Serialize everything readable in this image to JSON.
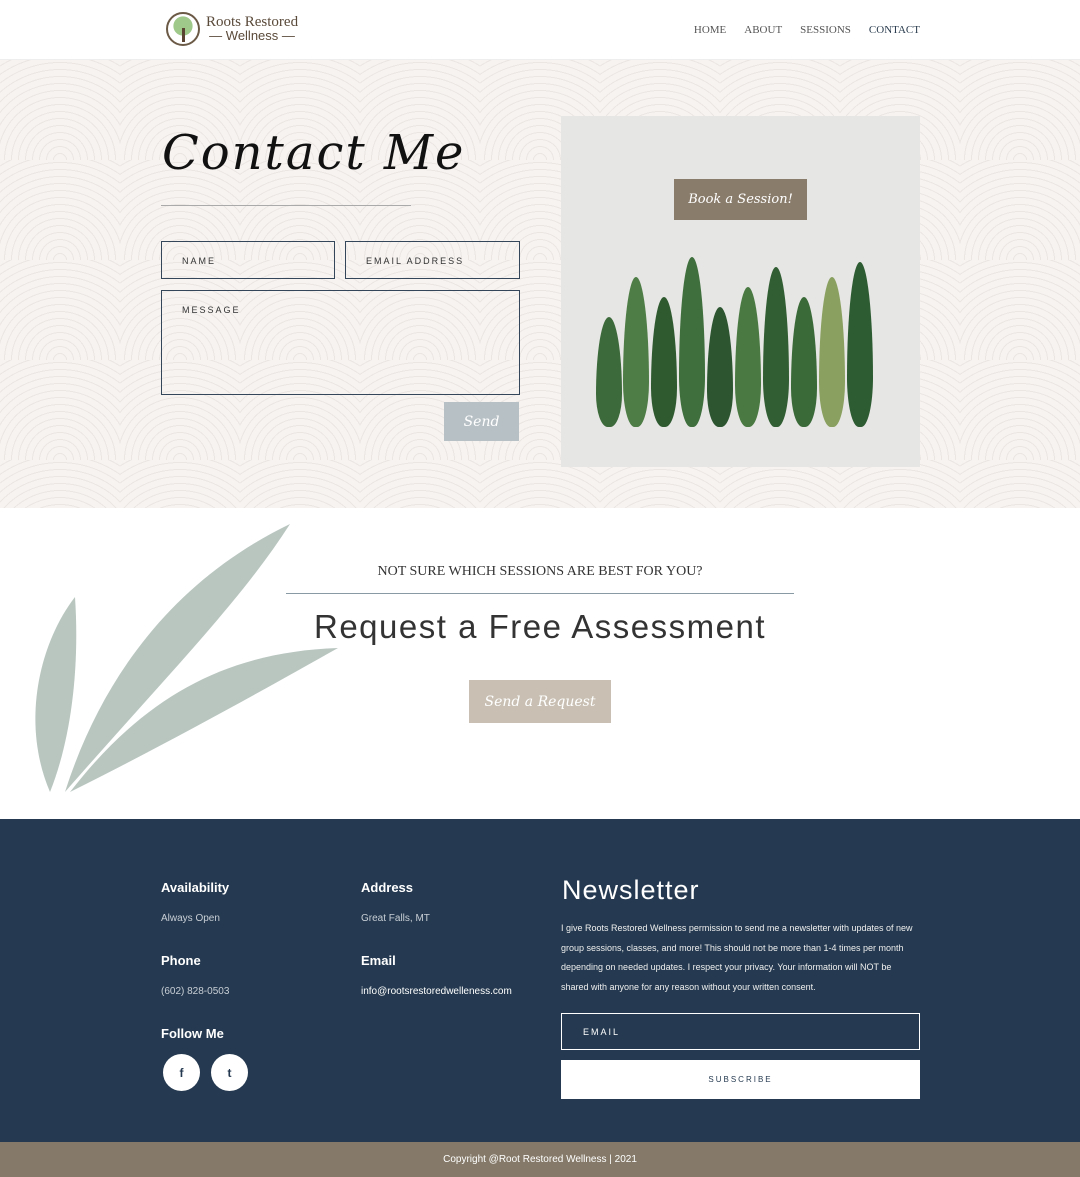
{
  "header": {
    "logo_line1": "Roots Restored",
    "logo_line2": "— Wellness —",
    "nav": [
      "HOME",
      "ABOUT",
      "SESSIONS",
      "CONTACT"
    ],
    "active": "CONTACT"
  },
  "contact": {
    "title": "Contact Me",
    "name_placeholder": "NAME",
    "email_placeholder": "EMAIL ADDRESS",
    "message_placeholder": "MESSAGE",
    "send_label": "Send",
    "book_label": "Book a Session!"
  },
  "cta": {
    "subtitle": "NOT SURE WHICH SESSIONS ARE BEST FOR YOU?",
    "title": "Request a Free Assessment",
    "button": "Send a Request"
  },
  "footer": {
    "availability_label": "Availability",
    "availability": "Always Open",
    "address_label": "Address",
    "address": "Great Falls, MT",
    "phone_label": "Phone",
    "phone": "(602) 828-0503",
    "email_label": "Email",
    "email": "info@rootsrestoredwelleness.com",
    "follow_label": "Follow Me",
    "social": [
      "f",
      "t"
    ],
    "newsletter_title": "Newsletter",
    "newsletter_text": "I give Roots Restored Wellness permission to send me a newsletter with updates of new group sessions, classes, and more! This should not be more than 1-4 times per month depending on needed updates. I respect your privacy. Your information will NOT be shared with anyone for any reason without your written consent.",
    "email_placeholder": "EMAIL",
    "subscribe": "SUBSCRIBE"
  },
  "copyright": "Copyright @Root Restored Wellness | 2021",
  "colors": {
    "navy": "#253a50",
    "taupe": "#857a69",
    "sage": "#b9c6c0"
  }
}
